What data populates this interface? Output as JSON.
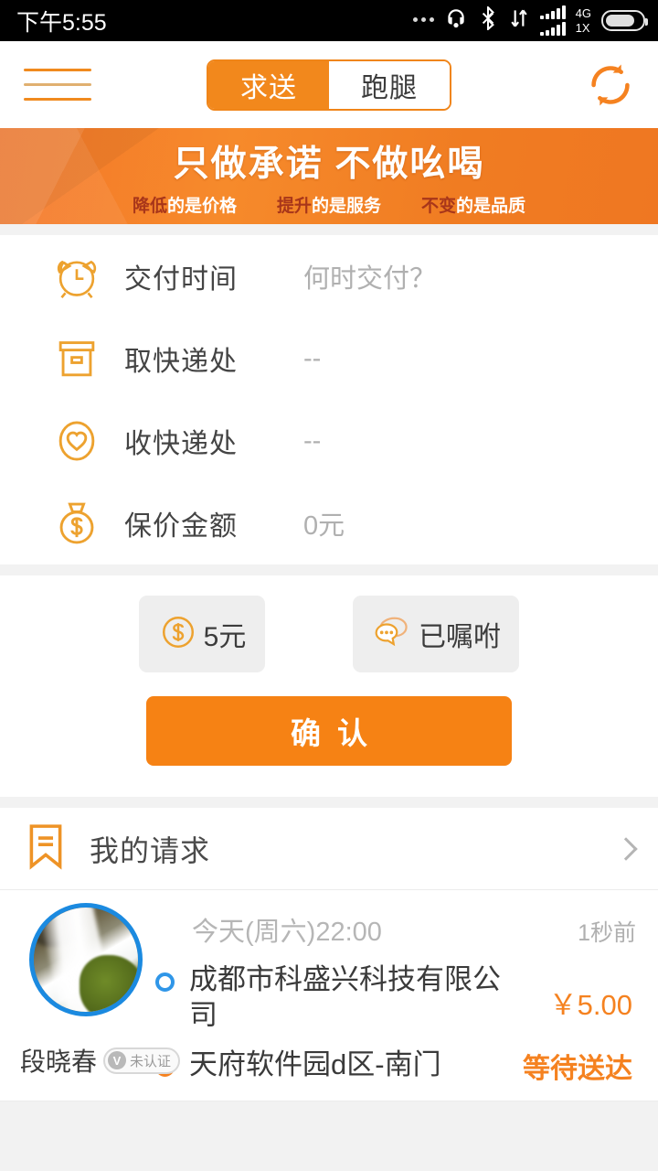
{
  "status_bar": {
    "time": "下午5:55",
    "network_top": "4G",
    "network_bottom": "1X",
    "icons": [
      "more-dots-icon",
      "headset-icon",
      "bluetooth-icon",
      "data-transfer-icon",
      "signal-bars-icon",
      "battery-icon"
    ]
  },
  "header": {
    "menu_icon": "hamburger-menu-icon",
    "refresh_icon": "refresh-icon",
    "tabs": [
      {
        "label": "求送",
        "active": true
      },
      {
        "label": "跑腿",
        "active": false
      }
    ]
  },
  "banner": {
    "title": "只做承诺 不做吆喝",
    "subtitle": [
      {
        "emphasis": "降低",
        "rest": "的是价格"
      },
      {
        "emphasis": "提升",
        "rest": "的是服务"
      },
      {
        "emphasis": "不变",
        "rest": "的是品质"
      }
    ]
  },
  "form": {
    "rows": [
      {
        "icon": "alarm-clock-icon",
        "label": "交付时间",
        "value": "何时交付？"
      },
      {
        "icon": "package-box-icon",
        "label": "取快递处",
        "value": "--"
      },
      {
        "icon": "heart-oval-icon",
        "label": "收快递处",
        "value": "--"
      },
      {
        "icon": "money-bag-icon",
        "label": "保价金额",
        "value": "0元"
      }
    ]
  },
  "actions": {
    "chips": [
      {
        "icon": "dollar-circle-icon",
        "label": "5元"
      },
      {
        "icon": "chat-bubbles-icon",
        "label": "已嘱咐"
      }
    ],
    "confirm_label": "确认"
  },
  "my_requests": {
    "icon": "bookmark-icon",
    "label": "我的请求",
    "chevron": "chevron-right-icon"
  },
  "order": {
    "user_name": "段晓春",
    "verify_badge": "未认证",
    "verify_mark": "V",
    "avatar": "waterfall-photo-avatar",
    "time": "今天(周六)22:00",
    "ago": "1秒前",
    "from_address": "成都市科盛兴科技有限公司",
    "to_address": "天府软件园d区-南门",
    "price": "￥5.00",
    "status": "等待送达"
  },
  "colors": {
    "accent_orange": "#f58220",
    "banner_orange": "#f4772a",
    "avatar_ring_blue": "#1b8ae0",
    "from_dot_blue": "#2f96e8",
    "muted_gray": "#b0b0b0"
  }
}
